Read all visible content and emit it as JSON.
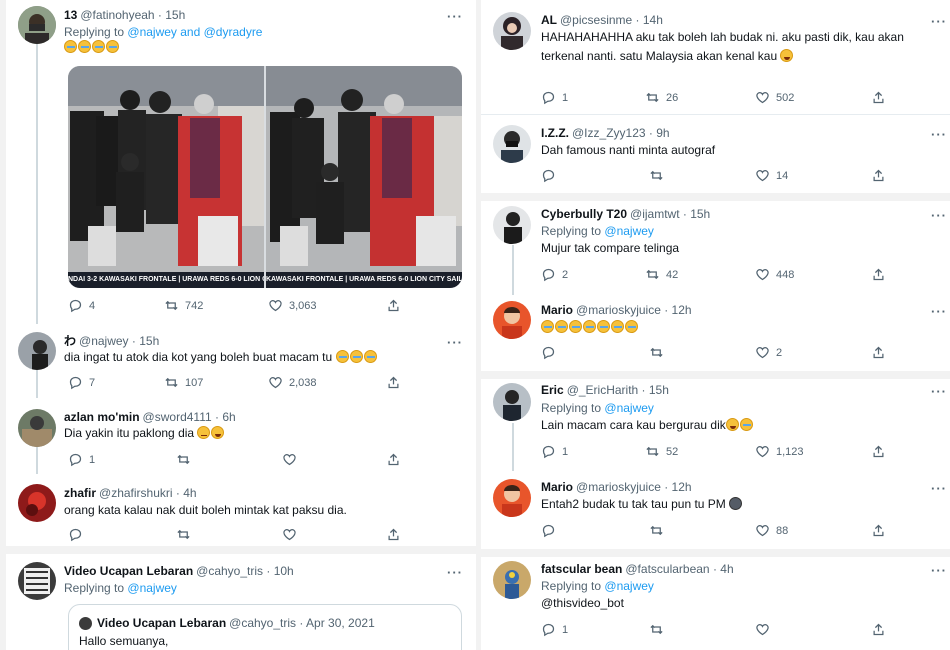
{
  "left": {
    "tweets": [
      {
        "name": "13",
        "handle": "@fatinohyeah · 15h",
        "replying_label": "Replying to",
        "replying_to": "@najwey and @dyradyre",
        "emoji_count": 4,
        "stats": {
          "replies": "4",
          "retweets": "742",
          "likes": "3,063"
        },
        "media": {
          "ticker_left": "NDAI 3-2 KAWASAKI FRONTALE   |   URAWA REDS 6-0 LION CI",
          "ticker_right": "KAWASAKI FRONTALE   |   URAWA REDS 6-0 LION CITY SAIL"
        }
      },
      {
        "name": "わ",
        "handle": "@najwey · 15h",
        "text": "dia ingat tu atok dia kot yang boleh buat macam tu",
        "stats": {
          "replies": "7",
          "retweets": "107",
          "likes": "2,038"
        }
      },
      {
        "name": "azlan mo'min",
        "handle": "@sword4111 · 6h",
        "text": "Dia yakin itu paklong dia",
        "stats": {
          "replies": "1",
          "retweets": "",
          "likes": ""
        }
      },
      {
        "name": "zhafir",
        "handle": "@zhafirshukri · 4h",
        "text": "orang kata kalau nak duit boleh mintak kat paksu dia.",
        "stats": {
          "replies": "",
          "retweets": "",
          "likes": ""
        }
      },
      {
        "name": "Video Ucapan Lebaran",
        "handle": "@cahyo_tris · 10h",
        "replying_label": "Replying to",
        "replying_to": "@najwey",
        "quote": {
          "name": "Video Ucapan Lebaran",
          "handle": "@cahyo_tris · Apr 30, 2021",
          "text": "Hallo semuanya,"
        }
      }
    ]
  },
  "right": {
    "tweets": [
      {
        "name": "AL",
        "handle": "@picsesinme · 14h",
        "text_line1": "HAHAHAHAHHA aku tak boleh lah budak ni. aku pasti dik, kau akan",
        "text_line2": "terkenal nanti. satu Malaysia akan kenal kau",
        "stats": {
          "replies": "1",
          "retweets": "26",
          "likes": "502"
        }
      },
      {
        "name": "I.Z.Z.",
        "handle": "@Izz_Zyy123 · 9h",
        "text": "Dah famous nanti minta autograf",
        "stats": {
          "replies": "",
          "retweets": "",
          "likes": "14"
        }
      },
      {
        "name": "Cyberbully T20",
        "handle": "@ijamtwt · 15h",
        "replying_label": "Replying to",
        "replying_to": "@najwey",
        "text": "Mujur tak compare telinga",
        "stats": {
          "replies": "2",
          "retweets": "42",
          "likes": "448"
        }
      },
      {
        "name": "Mario",
        "handle": "@marioskyjuice · 12h",
        "emoji_count": 7,
        "stats": {
          "replies": "",
          "retweets": "",
          "likes": "2"
        }
      },
      {
        "name": "Eric",
        "handle": "@_EricHarith · 15h",
        "replying_label": "Replying to",
        "replying_to": "@najwey",
        "text": "Lain macam cara kau bergurau dik",
        "stats": {
          "replies": "1",
          "retweets": "52",
          "likes": "1,123"
        }
      },
      {
        "name": "Mario",
        "handle": "@marioskyjuice · 12h",
        "text": "Entah2 budak tu tak tau pun tu PM",
        "stats": {
          "replies": "",
          "retweets": "",
          "likes": "88"
        }
      },
      {
        "name": "fatscular bean",
        "handle": "@fatscularbean · 4h",
        "replying_label": "Replying to",
        "replying_to": "@najwey",
        "link": "@thisvideo_bot",
        "stats": {
          "replies": "1",
          "retweets": "",
          "likes": ""
        }
      }
    ]
  },
  "icons": {
    "reply": "reply-icon",
    "retweet": "retweet-icon",
    "like": "heart-icon",
    "share": "share-icon",
    "more": "more-icon"
  },
  "more_glyph": "···",
  "colors": {
    "link": "#1d9bf0",
    "muted": "#536471",
    "divider": "#e6ecf0",
    "line": "#cfd9de"
  }
}
